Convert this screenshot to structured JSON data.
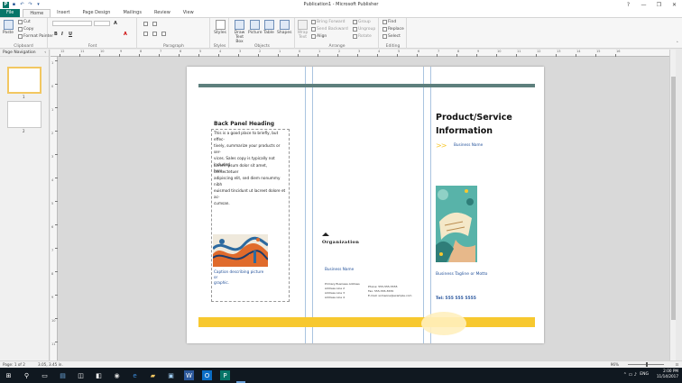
{
  "window": {
    "title": "Publication1 - Microsoft Publisher",
    "quick_access": [
      "save-icon",
      "undo-icon",
      "redo-icon"
    ],
    "controls": {
      "help": "?",
      "minimize": "—",
      "restore": "❐",
      "close": "✕"
    }
  },
  "tabs": {
    "file": "File",
    "items": [
      "Home",
      "Insert",
      "Page Design",
      "Mailings",
      "Review",
      "View"
    ],
    "active": "Home"
  },
  "ribbon": {
    "clipboard": {
      "label": "Clipboard",
      "paste": "Paste",
      "cut": "Cut",
      "copy": "Copy",
      "format_painter": "Format Painter"
    },
    "font": {
      "label": "Font",
      "bold": "B",
      "italic": "I",
      "underline": "U",
      "font_size_grow": "A",
      "font_color": "A"
    },
    "paragraph": {
      "label": "Paragraph"
    },
    "styles": {
      "label": "Styles",
      "button": "Styles"
    },
    "objects": {
      "label": "Objects",
      "draw_text_box": "Draw Text Box",
      "picture": "Picture",
      "table": "Table",
      "shapes": "Shapes"
    },
    "arrange": {
      "label": "Arrange",
      "wrap_text": "Wrap Text",
      "bring_forward": "Bring Forward",
      "send_backward": "Send Backward",
      "align": "Align",
      "group": "Group",
      "ungroup": "Ungroup",
      "rotate": "Rotate"
    },
    "editing": {
      "label": "Editing",
      "find": "Find",
      "replace": "Replace",
      "select": "Select"
    }
  },
  "nav": {
    "title": "Page Navigation",
    "pages": [
      {
        "number": "1"
      },
      {
        "number": "2"
      }
    ]
  },
  "ruler_h": [
    "12",
    "11",
    "10",
    "9",
    "8",
    "7",
    "6",
    "5",
    "4",
    "3",
    "2",
    "1",
    "0",
    "1",
    "2",
    "3",
    "4",
    "5",
    "6",
    "7",
    "8",
    "9",
    "10",
    "11",
    "12",
    "13",
    "14",
    "15",
    "16"
  ],
  "ruler_v": [
    "1",
    "0",
    "1",
    "2",
    "3",
    "4",
    "5",
    "6",
    "7",
    "8",
    "9",
    "10",
    "11"
  ],
  "publication": {
    "back_panel_heading": "Back Panel Heading",
    "back_panel_body1": "This is a good place to briefly, but effec-\ntively, summarize your products or ser-\nvices. Sales copy is typically not included\nhere.",
    "back_panel_body2": "Lorem ipsum dolor sit amet, consectetuer\nadipiscing elit, sed diem nonummy nibh\neuismod tincidunt ut lacreet dolore et ac-\ncumsan.",
    "caption": "Caption describing picture or\ngraphic.",
    "organization": "Organization",
    "business_name_mid": "Business Name",
    "address": "Primary Business Address\nAddress Line 2\nAddress Line 3\nAddress Line 4",
    "contact": "Phone: 555-555-5555\nFax: 555-555-5555\nE-mail: someone@example.com",
    "product_title": "Product/Service Information",
    "chevrons": ">>",
    "business_name_right": "Business Name",
    "tagline": "Business Tagline or Motto",
    "tel": "Tel: 555 555 5555",
    "colors": {
      "teal_bar": "#5e7f7d",
      "yellow_bar": "#f7c82f",
      "blue_text": "#1f4e98"
    }
  },
  "status": {
    "page": "Page: 1 of 2",
    "position": "3.05, 3.45 in.",
    "zoom": "96%"
  },
  "taskbar": {
    "icons": [
      "windows-logo-icon",
      "search-icon",
      "task-view-icon",
      "film-icon",
      "store-icon",
      "chrome-icon",
      "edge-icon",
      "folder-icon",
      "photos-icon",
      "word-icon",
      "outlook-icon",
      "publisher-icon"
    ],
    "time": "2:00 PM",
    "date": "11/14/2017",
    "lang": "ENG"
  }
}
